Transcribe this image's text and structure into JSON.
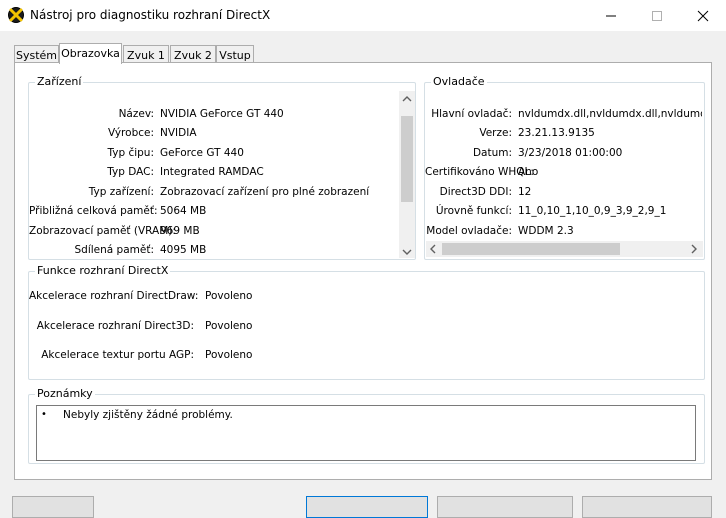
{
  "window": {
    "title": "Nástroj pro diagnostiku rozhraní DirectX"
  },
  "tabs": [
    {
      "label": "Systém"
    },
    {
      "label": "Obrazovka"
    },
    {
      "label": "Zvuk 1"
    },
    {
      "label": "Zvuk 2"
    },
    {
      "label": "Vstup"
    }
  ],
  "active_tab": "Obrazovka",
  "device": {
    "heading": "Zařízení",
    "rows": [
      {
        "label": "Název:",
        "value": "NVIDIA GeForce GT 440"
      },
      {
        "label": "Výrobce:",
        "value": "NVIDIA"
      },
      {
        "label": "Typ čipu:",
        "value": "GeForce GT 440"
      },
      {
        "label": "Typ DAC:",
        "value": "Integrated RAMDAC"
      },
      {
        "label": "Typ zařízení:",
        "value": "Zobrazovací zařízení pro plné zobrazení"
      },
      {
        "label": "Přibližná celková paměť:",
        "value": "5064 MB"
      },
      {
        "label": "Zobrazovací paměť (VRAM):",
        "value": "969 MB"
      },
      {
        "label": "Sdílená paměť:",
        "value": "4095 MB"
      }
    ]
  },
  "drivers": {
    "heading": "Ovladače",
    "rows": [
      {
        "label": "Hlavní ovladač:",
        "value": "nvldumdx.dll,nvldumdx.dll,nvldumdx.dll"
      },
      {
        "label": "Verze:",
        "value": "23.21.13.9135"
      },
      {
        "label": "Datum:",
        "value": "3/23/2018 01:00:00"
      },
      {
        "label": "Certifikováno WHQL:",
        "value": "Ano"
      },
      {
        "label": "Direct3D DDI:",
        "value": "12"
      },
      {
        "label": "Úrovně funkcí:",
        "value": "11_0,10_1,10_0,9_3,9_2,9_1"
      },
      {
        "label": "Model ovladače:",
        "value": "WDDM 2.3"
      }
    ]
  },
  "directx_features": {
    "heading": "Funkce rozhraní DirectX",
    "rows": [
      {
        "label": "Akcelerace rozhraní DirectDraw:",
        "value": "Povoleno"
      },
      {
        "label": "Akcelerace rozhraní Direct3D:",
        "value": "Povoleno"
      },
      {
        "label": "Akcelerace textur portu AGP:",
        "value": "Povoleno"
      }
    ]
  },
  "notes": {
    "heading": "Poznámky",
    "items": [
      "Nebyly zjištěny žádné problémy."
    ]
  }
}
